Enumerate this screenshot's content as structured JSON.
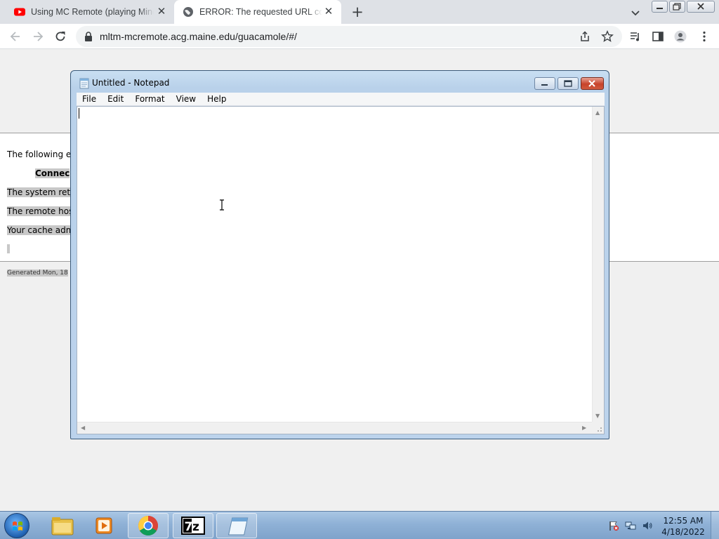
{
  "browser": {
    "tabs": [
      {
        "title": "Using MC Remote (playing Mine",
        "icon": "youtube-icon",
        "active": false
      },
      {
        "title": "ERROR: The requested URL could",
        "icon": "globe-icon",
        "active": true
      }
    ],
    "address": "mltm-mcremote.acg.maine.edu/guacamole/#/"
  },
  "error_page": {
    "line1": "The following e",
    "heading": "Connec",
    "line2": "The system ret",
    "line3": "The remote hos",
    "line4": "Your cache adm",
    "line5": "",
    "generated": "Generated Mon, 18"
  },
  "notepad": {
    "title": "Untitled - Notepad",
    "menu": [
      "File",
      "Edit",
      "Format",
      "View",
      "Help"
    ],
    "content": ""
  },
  "taskbar": {
    "time": "12:55 AM",
    "date": "4/18/2022",
    "items": [
      "explorer-icon",
      "media-player-icon",
      "chrome-icon",
      "7zip-icon",
      "notepad-icon"
    ]
  },
  "colors": {
    "youtube_red": "#ff0000",
    "chrome_tabstrip": "#dee1e6",
    "taskbar_blue": "#8fb1d6",
    "close_red": "#c7432a"
  }
}
